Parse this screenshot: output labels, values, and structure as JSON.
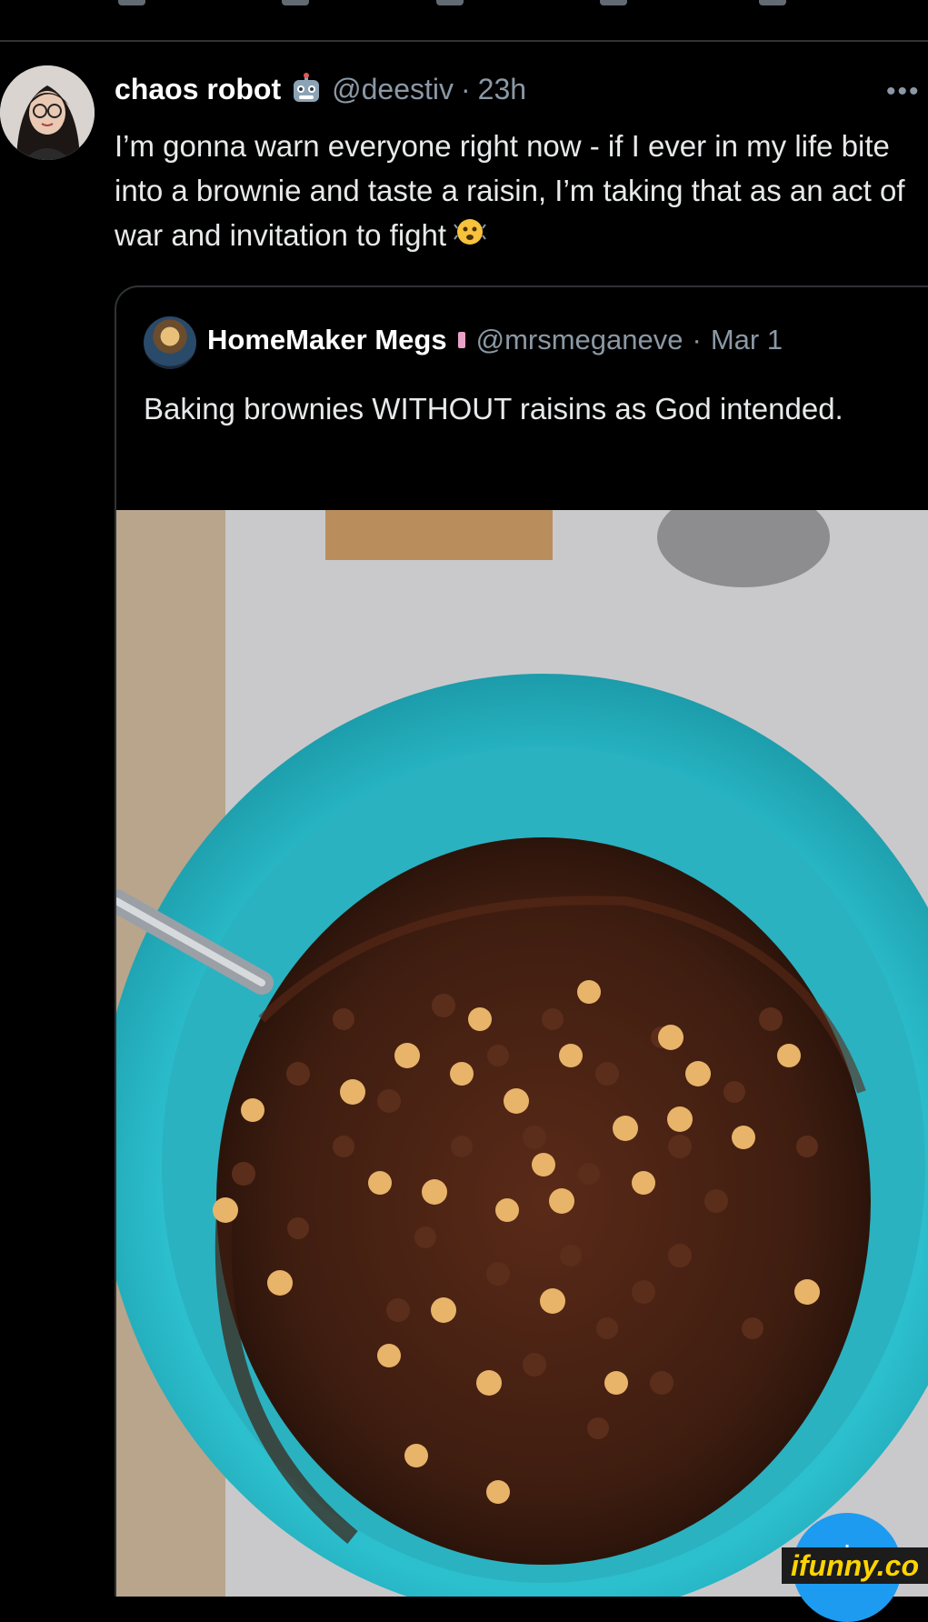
{
  "tweet": {
    "author_name": "chaos robot",
    "author_emoji": "robot-face-icon",
    "handle": "@deestiv",
    "separator": "·",
    "time": "23h",
    "more_label": "•••",
    "text": "I’m gonna warn everyone right now - if I ever in my life bite into a brownie and taste a raisin, I’m taking that as an act of war and invitation to fight",
    "trailing_emoji": "shaking-face-icon"
  },
  "quoted_tweet": {
    "author_name": "HomeMaker Megs",
    "badge": "pink-ribbon-icon",
    "handle": "@mrsmeganeve",
    "separator": "·",
    "time": "Mar 1",
    "text": "Baking brownies WITHOUT raisins as God intended.",
    "image": "brownie-batter-in-teal-bowl-with-chocolate-and-peanut-butter-chips"
  },
  "fab": {
    "label": "+",
    "icon": "compose-icon"
  },
  "watermark": {
    "text": "ifunny.co"
  },
  "colors": {
    "background": "#000000",
    "text": "#e7e9ea",
    "muted": "#8b98a5",
    "border": "#2f3336",
    "accent": "#1d9bf0",
    "bowl": "#2cb5c4",
    "batter": "#4a2314"
  }
}
